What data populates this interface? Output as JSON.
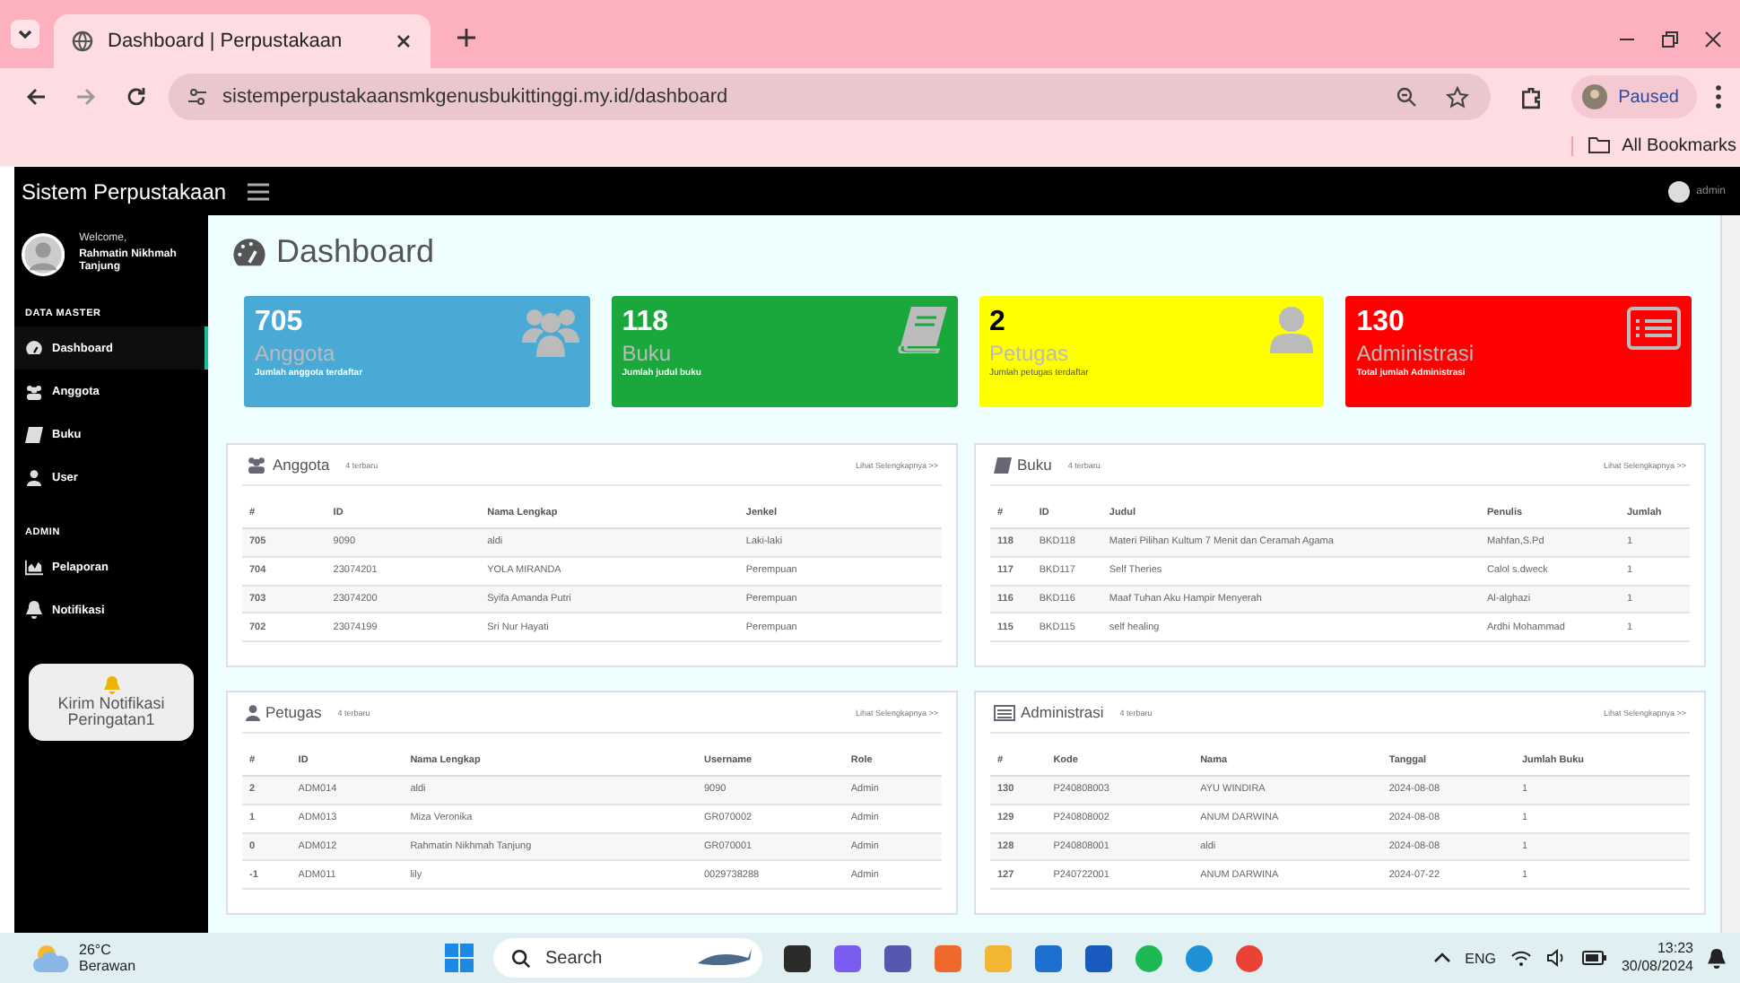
{
  "browser": {
    "tab_title": "Dashboard | Perpustakaan",
    "url": "sistemperpustakaansmkgenusbukittinggi.my.id/dashboard",
    "profile": "Paused",
    "bookmarks": "All Bookmarks"
  },
  "navbar": {
    "brand": "Sistem Perpustakaan",
    "user": "admin"
  },
  "sidebar": {
    "welcome": "Welcome,",
    "name": "Rahmatin Nikhmah Tanjung",
    "sections": [
      {
        "title": "DATA MASTER",
        "items": [
          {
            "label": "Dashboard",
            "kind": "gauge",
            "selected": true
          },
          {
            "label": "Anggota",
            "kind": "users",
            "selected": false
          },
          {
            "label": "Buku",
            "kind": "book",
            "selected": false
          },
          {
            "label": "User",
            "kind": "user",
            "selected": false
          }
        ]
      },
      {
        "title": "ADMIN",
        "items": [
          {
            "label": "Pelaporan",
            "kind": "chart",
            "selected": false
          },
          {
            "label": "Notifikasi",
            "kind": "bell",
            "selected": false
          }
        ]
      }
    ],
    "notify_button": "Kirim Notifikasi Peringatan1"
  },
  "page_title": "Dashboard",
  "stats": [
    {
      "value": "705",
      "label": "Anggota",
      "caption": "Jumlah anggota terdaftar",
      "color": "#4aaad6",
      "kind": "users"
    },
    {
      "value": "118",
      "label": "Buku",
      "caption": "Jumlah judul buku",
      "color": "#1aa83c",
      "kind": "book"
    },
    {
      "value": "2",
      "label": "Petugas",
      "caption": "Jumlah petugas terdaftar",
      "color": "#ffff00",
      "kind": "user"
    },
    {
      "value": "130",
      "label": "Administrasi",
      "caption": "Total jumlah Administrasi",
      "color": "#ff0000",
      "kind": "list"
    }
  ],
  "panels": [
    {
      "title": "Anggota",
      "subtitle": "4 terbaru",
      "link": "Lihat Selengkapnya >>",
      "kind": "users",
      "columns": [
        "#",
        "ID",
        "Nama Lengkap",
        "Jenkel"
      ],
      "rows": [
        [
          "705",
          "9090",
          "aldi",
          "Laki-laki"
        ],
        [
          "704",
          "23074201",
          "YOLA MIRANDA",
          "Perempuan"
        ],
        [
          "703",
          "23074200",
          "Syifa Amanda Putri",
          "Perempuan"
        ],
        [
          "702",
          "23074199",
          "Sri Nur Hayati",
          "Perempuan"
        ]
      ]
    },
    {
      "title": "Buku",
      "subtitle": "4 terbaru",
      "link": "Lihat Selengkapnya >>",
      "kind": "book",
      "columns": [
        "#",
        "ID",
        "Judul",
        "Penulis",
        "Jumlah"
      ],
      "rows": [
        [
          "118",
          "BKD118",
          "Materi Pilihan Kultum 7 Menit dan Ceramah Agama",
          "Mahfan,S.Pd",
          "1"
        ],
        [
          "117",
          "BKD117",
          "Self Theries",
          "Calol s.dweck",
          "1"
        ],
        [
          "116",
          "BKD116",
          "Maaf Tuhan Aku Hampir Menyerah",
          "Al-alghazi",
          "1"
        ],
        [
          "115",
          "BKD115",
          "self healing",
          "Ardhi Mohammad",
          "1"
        ]
      ]
    },
    {
      "title": "Petugas",
      "subtitle": "4 terbaru",
      "link": "Lihat Selengkapnya >>",
      "kind": "user",
      "columns": [
        "#",
        "ID",
        "Nama Lengkap",
        "Username",
        "Role"
      ],
      "rows": [
        [
          "2",
          "ADM014",
          "aldi",
          "9090",
          "Admin"
        ],
        [
          "1",
          "ADM013",
          "Miza Veronika",
          "GR070002",
          "Admin"
        ],
        [
          "0",
          "ADM012",
          "Rahmatin Nikhmah Tanjung",
          "GR070001",
          "Admin"
        ],
        [
          "-1",
          "ADM011",
          "lily",
          "0029738288",
          "Admin"
        ]
      ]
    },
    {
      "title": "Administrasi",
      "subtitle": "4 terbaru",
      "link": "Lihat Selengkapnya >>",
      "kind": "list",
      "columns": [
        "#",
        "Kode",
        "Nama",
        "Tanggal",
        "Jumlah Buku"
      ],
      "rows": [
        [
          "130",
          "P240808003",
          "AYU WINDIRA",
          "2024-08-08",
          "1"
        ],
        [
          "129",
          "P240808002",
          "ANUM DARWINA",
          "2024-08-08",
          "1"
        ],
        [
          "128",
          "P240808001",
          "aldi",
          "2024-08-08",
          "1"
        ],
        [
          "127",
          "P240722001",
          "ANUM DARWINA",
          "2024-07-22",
          "1"
        ]
      ]
    }
  ],
  "taskbar": {
    "temperature": "26°C",
    "weather": "Berawan",
    "search": "Search",
    "language": "ENG",
    "time": "13:23",
    "date": "30/08/2024"
  }
}
